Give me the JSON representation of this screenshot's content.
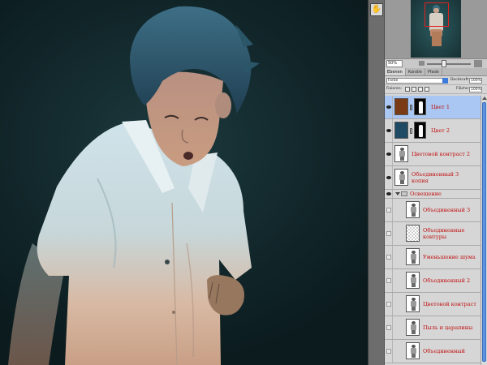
{
  "navigator": {
    "zoom": "50%"
  },
  "tool_strip": {
    "icon": "hand-tool-icon",
    "glyph": "✋"
  },
  "layers_panel": {
    "tabs": [
      {
        "label": "Ebenen",
        "active": true
      },
      {
        "label": "Kanäle",
        "active": false
      },
      {
        "label": "Pfade",
        "active": false
      }
    ],
    "blend_mode": "Farbe",
    "opacity_label": "Deckkraft:",
    "opacity_value": "100%",
    "lock_label": "Fixieren:",
    "fill_label": "Fläche:",
    "fill_value": "100%",
    "layers": [
      {
        "name": "Цвет 1",
        "kind": "fill",
        "swatch": "#7a3a14",
        "visible": true,
        "selected": true
      },
      {
        "name": "Цвет 2",
        "kind": "fill",
        "swatch": "#1f4a63",
        "visible": true,
        "selected": false
      },
      {
        "name": "Цветовой контраст 2",
        "kind": "photo",
        "visible": true,
        "selected": false
      },
      {
        "name_line1": "Объединенный 3",
        "name_line2": "копия",
        "kind": "photo2",
        "visible": true,
        "selected": false
      },
      {
        "name": "Освещение",
        "kind": "group",
        "visible": true
      },
      {
        "name": "Объединенный 3",
        "kind": "photo",
        "visible": false,
        "indent": true
      },
      {
        "name_line1": "Объединенные",
        "name_line2": "контуры",
        "kind": "checker2",
        "visible": false,
        "indent": true
      },
      {
        "name": "Уменьшение шума",
        "kind": "photo",
        "visible": false,
        "indent": true
      },
      {
        "name": "Объединенный 2",
        "kind": "photo",
        "visible": false,
        "indent": true
      },
      {
        "name": "Цветовой контраст",
        "kind": "photo",
        "visible": false,
        "indent": true
      },
      {
        "name": "Пыль и царапины",
        "kind": "photo",
        "visible": false,
        "indent": true
      },
      {
        "name": "Объединенный",
        "kind": "photo",
        "visible": false,
        "indent": true
      }
    ]
  },
  "colors": {
    "selected_row": "#a9c7f2",
    "layer_name_text": "#c01010",
    "scroll_thumb": "#5d93e0"
  }
}
